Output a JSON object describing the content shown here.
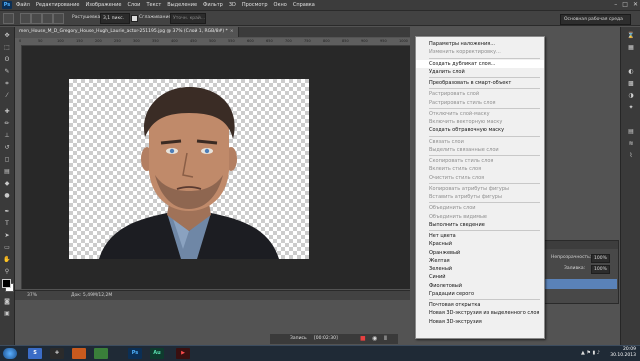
{
  "app": {
    "logo": "Ps"
  },
  "menu": [
    "Файл",
    "Редактирование",
    "Изображение",
    "Слои",
    "Текст",
    "Выделение",
    "Фильтр",
    "3D",
    "Просмотр",
    "Окно",
    "Справка"
  ],
  "window_controls": [
    "–",
    "□",
    "✕"
  ],
  "options_bar": {
    "feather_label": "Растушевка:",
    "feather_value": "3,1 пикс.",
    "antialias_label": "Сглаживание",
    "refine_edge": "Уточн. край..."
  },
  "workspace": "Основная рабочая среда",
  "document": {
    "tab_title": "men_House_M_D_Gregory_House_Hugh_Laurie_actor-251195.jpg @ 37% (Слой 1, RGB/8#) *",
    "close": "×",
    "ruler_ticks": [
      "0",
      "50",
      "100",
      "150",
      "200",
      "250",
      "300",
      "350",
      "400",
      "450",
      "500",
      "550",
      "600",
      "650",
      "700",
      "750",
      "800",
      "850",
      "900",
      "950",
      "1000"
    ]
  },
  "statusbar": {
    "zoom": "37%",
    "doc": "Док: 5,49M/12,2M"
  },
  "layers_panel": {
    "opacity_label": "Непрозрачность:",
    "opacity_value": "100%",
    "fill_label": "Заливка:",
    "fill_value": "100%"
  },
  "context_menu": [
    {
      "label": "Параметры наложения...",
      "disabled": false
    },
    {
      "label": "Изменить корректировку...",
      "disabled": true
    },
    {
      "sep": true
    },
    {
      "label": "Создать дубликат слоя...",
      "disabled": false,
      "hover": true
    },
    {
      "label": "Удалить слой",
      "disabled": false
    },
    {
      "sep": true
    },
    {
      "label": "Преобразовать в смарт-объект",
      "disabled": false
    },
    {
      "sep": true
    },
    {
      "label": "Растрировать слой",
      "disabled": true
    },
    {
      "label": "Растрировать стиль слоя",
      "disabled": true
    },
    {
      "sep": true
    },
    {
      "label": "Отключить слой-маску",
      "disabled": true
    },
    {
      "label": "Включить векторную маску",
      "disabled": true
    },
    {
      "label": "Создать обтравочную маску",
      "disabled": false
    },
    {
      "sep": true
    },
    {
      "label": "Связать слои",
      "disabled": true
    },
    {
      "label": "Выделить связанные слои",
      "disabled": true
    },
    {
      "sep": true
    },
    {
      "label": "Скопировать стиль слоя",
      "disabled": true
    },
    {
      "label": "Вклеить стиль слоя",
      "disabled": true
    },
    {
      "label": "Очистить стиль слоя",
      "disabled": true
    },
    {
      "sep": true
    },
    {
      "label": "Копировать атрибуты фигуры",
      "disabled": true
    },
    {
      "label": "Вставить атрибуты фигуры",
      "disabled": true
    },
    {
      "sep": true
    },
    {
      "label": "Объединить слои",
      "disabled": true
    },
    {
      "label": "Объединить видимые",
      "disabled": true
    },
    {
      "label": "Выполнить сведение",
      "disabled": false
    },
    {
      "sep": true
    },
    {
      "label": "Нет цвета",
      "disabled": false
    },
    {
      "label": "Красный",
      "disabled": false
    },
    {
      "label": "Оранжевый",
      "disabled": false
    },
    {
      "label": "Желтая",
      "disabled": false
    },
    {
      "label": "Зеленый",
      "disabled": false
    },
    {
      "label": "Синий",
      "disabled": false
    },
    {
      "label": "Фиолетовый",
      "disabled": false
    },
    {
      "label": "Градации серого",
      "disabled": false
    },
    {
      "sep": true
    },
    {
      "label": "Почтовая открытка",
      "disabled": false
    },
    {
      "label": "Новая 3D-экструзия из выделенного слоя",
      "disabled": false
    },
    {
      "label": "Новая 3D-экструзия",
      "disabled": false
    }
  ],
  "recorder": {
    "label": "Запись",
    "time": "[00:02:30]"
  },
  "taskbar": {
    "apps": [
      "S",
      "✚",
      "Ps",
      "Au",
      "▶"
    ],
    "clock_time": "20:09",
    "clock_date": "30.10.2013"
  }
}
